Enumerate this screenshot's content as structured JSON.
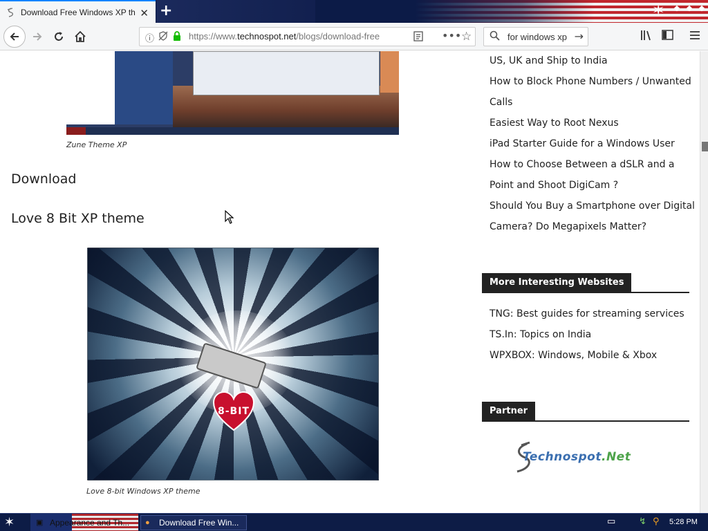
{
  "browser": {
    "tab": {
      "title": "Download Free Windows XP theme",
      "favicon": "technospot-favicon",
      "close_icon": "close-icon"
    },
    "new_tab_icon": "plus-icon",
    "url": {
      "prefix": "https://www.",
      "domain": "technospot.net",
      "path": "/blogs/download-free"
    },
    "search": {
      "value": "for windows xp",
      "icon": "search-icon"
    },
    "nav_icons": [
      "back-arrow-icon",
      "forward-arrow-icon",
      "reload-icon",
      "home-icon"
    ]
  },
  "article": {
    "caption1": "Zune Theme XP",
    "heading_download": "Download",
    "heading_theme": "Love 8 Bit XP theme",
    "image2_text": "8-BIT",
    "caption2": "Love 8-bit Windows XP theme"
  },
  "sidebar": {
    "links": [
      {
        "text": "US, UK and Ship to India"
      },
      {
        "text": "How to Block Phone Numbers / Unwanted"
      },
      {
        "text": "Calls"
      },
      {
        "text": "Easiest Way to Root Nexus"
      },
      {
        "text": "iPad Starter Guide for a Windows User"
      },
      {
        "text": "How to Choose Between a dSLR and a"
      },
      {
        "text": "Point and Shoot DigiCam ?"
      },
      {
        "text": "Should You Buy a Smartphone over Digital"
      },
      {
        "text": "Camera? Do Megapixels Matter?"
      }
    ],
    "websites_heading": "More Interesting Websites",
    "websites": [
      {
        "text": "TNG: Best guides for streaming services"
      },
      {
        "text": "TS.In: Topics on India"
      },
      {
        "text": "WPXBOX: Windows, Mobile & Xbox"
      }
    ],
    "partner_heading": "Partner",
    "partner_logo": {
      "word": "Technospot",
      "suffix": ".Net"
    }
  },
  "taskbar": {
    "items": [
      {
        "label": "Appearance and Th..."
      },
      {
        "label": "Download Free Win..."
      }
    ],
    "clock": "5:28 PM"
  },
  "colors": {
    "accent": "#0a84ff",
    "widget_head": "#222222",
    "taskbar": "#0d1c46"
  }
}
